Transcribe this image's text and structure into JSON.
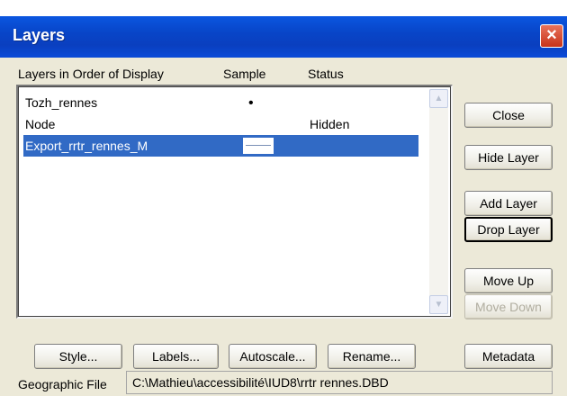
{
  "window": {
    "title": "Layers"
  },
  "columns": {
    "layers": "Layers in Order of Display",
    "sample": "Sample",
    "status": "Status"
  },
  "layers": [
    {
      "name": "Tozh_rennes",
      "sample": "point",
      "status": "",
      "selected": false
    },
    {
      "name": "Node",
      "sample": "",
      "status": "Hidden",
      "selected": false
    },
    {
      "name": "Export_rrtr_rennes_M",
      "sample": "line",
      "status": "",
      "selected": true
    }
  ],
  "buttons": {
    "close": "Close",
    "hide_layer": "Hide Layer",
    "add_layer": "Add Layer",
    "drop_layer": "Drop Layer",
    "move_up": "Move Up",
    "move_down": "Move Down",
    "metadata": "Metadata",
    "style": "Style...",
    "labels": "Labels...",
    "autoscale": "Autoscale...",
    "rename": "Rename..."
  },
  "geographic_file": {
    "label": "Geographic File",
    "value": "C:\\Mathieu\\accessibilité\\IUD8\\rrtr rennes.DBD"
  },
  "colors": {
    "titlebar": "#0a4fd6",
    "selection": "#316ac5",
    "dialog_bg": "#ece9d8"
  }
}
